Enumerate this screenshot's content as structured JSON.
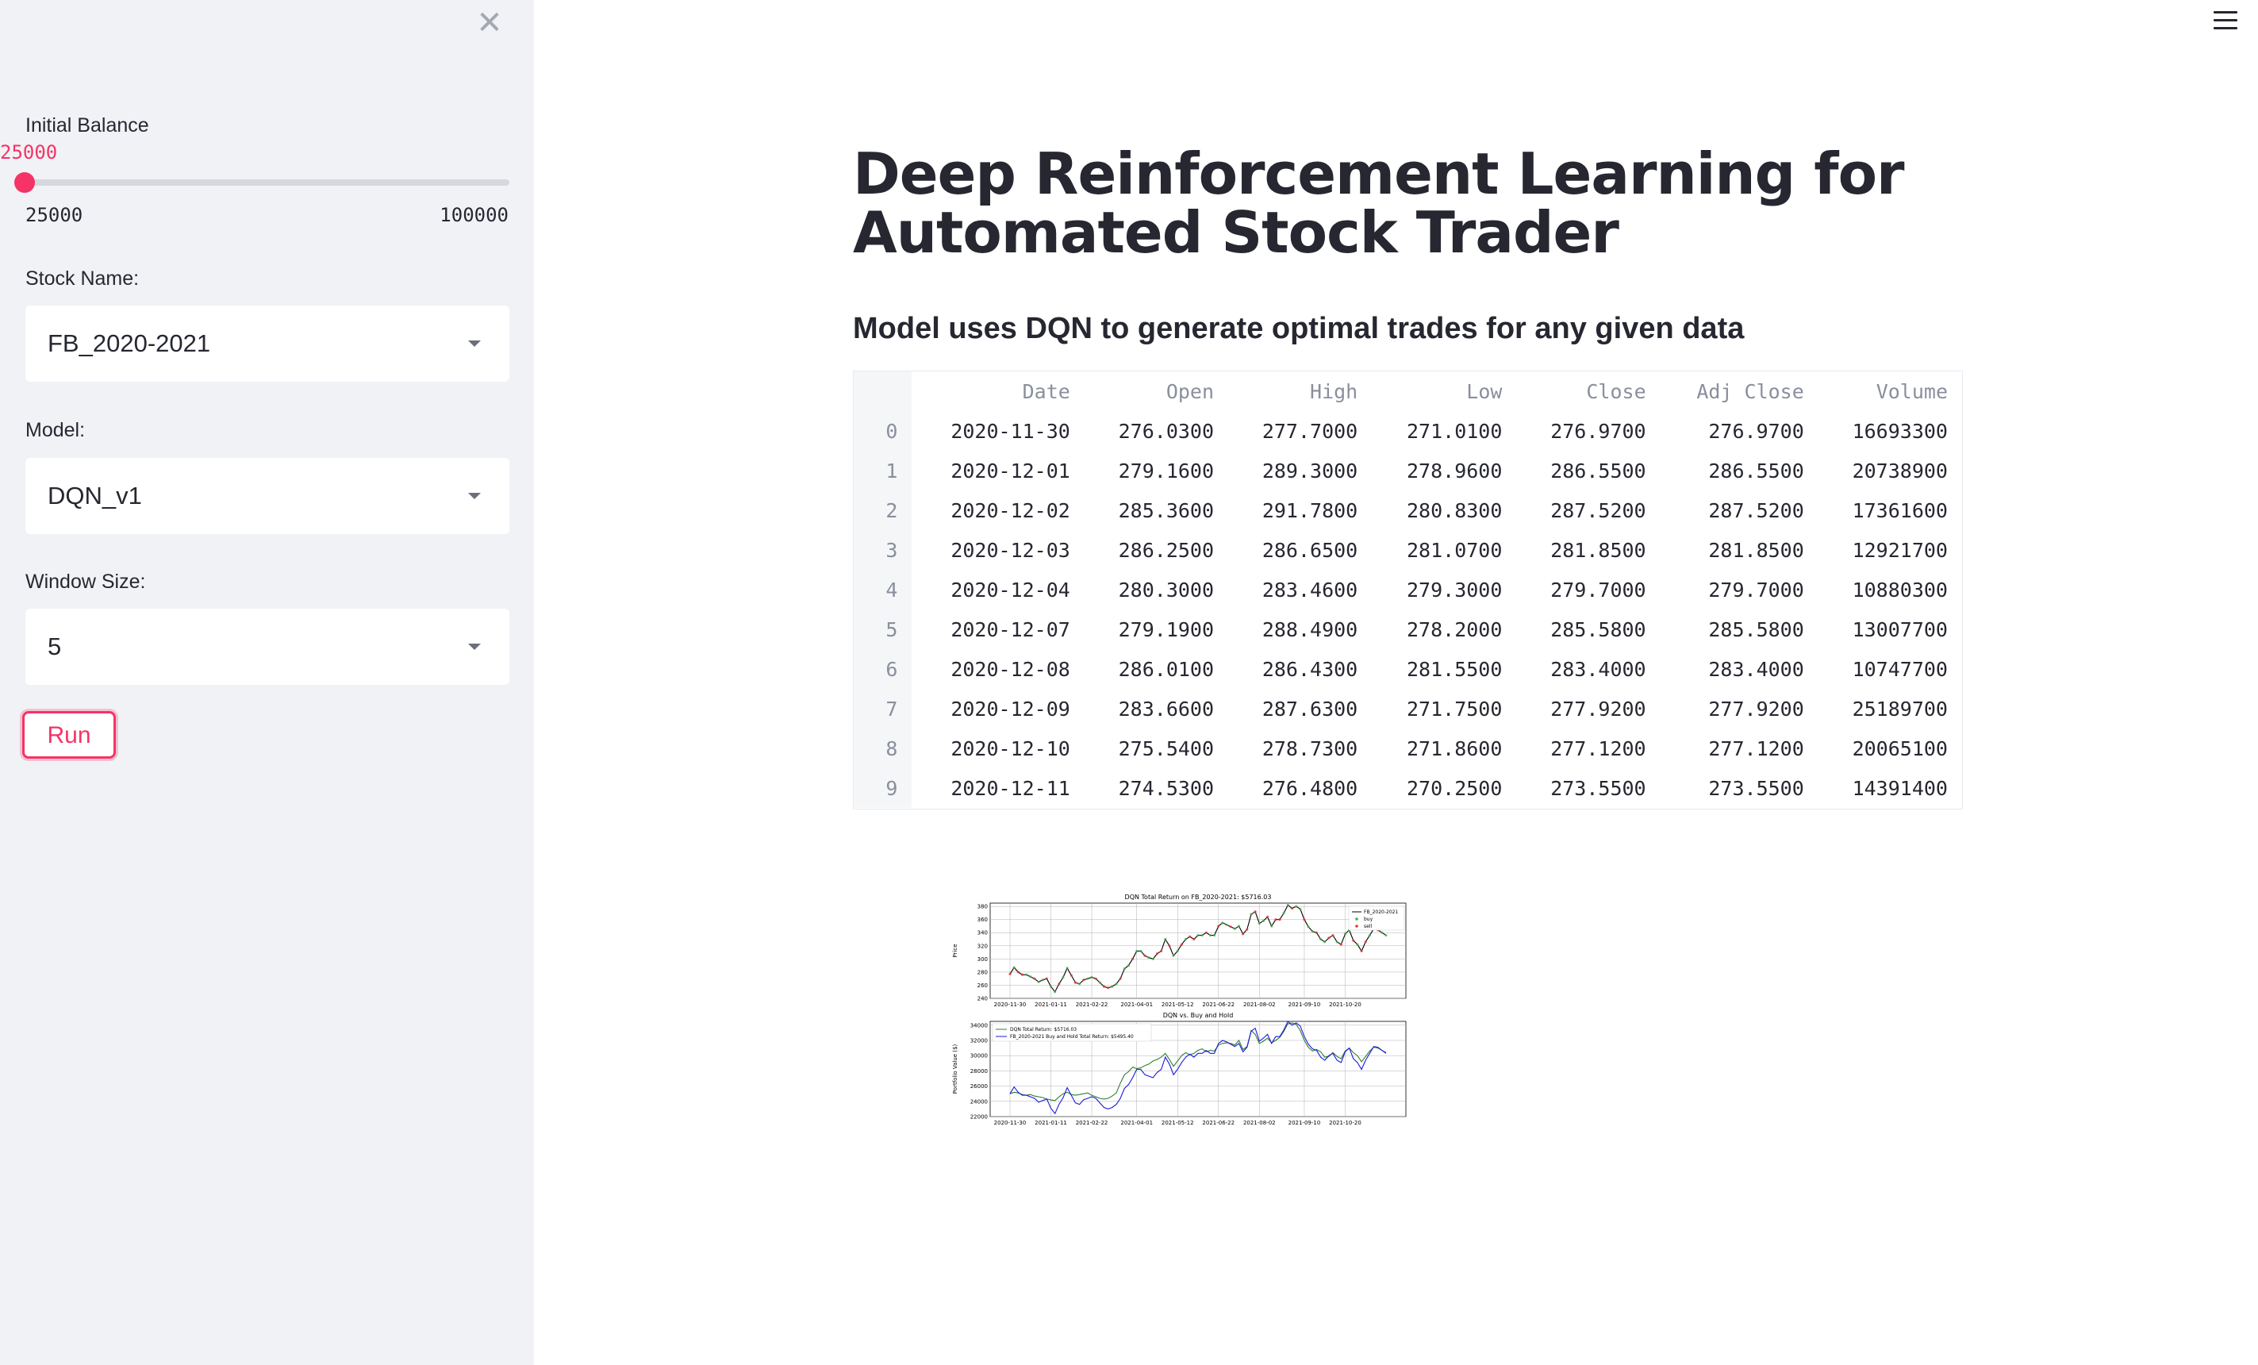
{
  "sidebar": {
    "close_label": "✕",
    "initial_balance": {
      "label": "Initial Balance",
      "value": "25000",
      "min": "25000",
      "max": "100000",
      "fraction": 0.0
    },
    "stock_name": {
      "label": "Stock Name:",
      "value": "FB_2020-2021"
    },
    "model": {
      "label": "Model:",
      "value": "DQN_v1"
    },
    "window_size": {
      "label": "Window Size:",
      "value": "5"
    },
    "run_label": "Run"
  },
  "main": {
    "title_line1": "Deep Reinforcement Learning for",
    "title_line2": "Automated Stock Trader",
    "subtitle": "Model uses DQN to generate optimal trades for any given data",
    "table": {
      "columns": [
        "Date",
        "Open",
        "High",
        "Low",
        "Close",
        "Adj Close",
        "Volume"
      ],
      "rows": [
        [
          "0",
          "2020-11-30",
          "276.0300",
          "277.7000",
          "271.0100",
          "276.9700",
          "276.9700",
          "16693300"
        ],
        [
          "1",
          "2020-12-01",
          "279.1600",
          "289.3000",
          "278.9600",
          "286.5500",
          "286.5500",
          "20738900"
        ],
        [
          "2",
          "2020-12-02",
          "285.3600",
          "291.7800",
          "280.8300",
          "287.5200",
          "287.5200",
          "17361600"
        ],
        [
          "3",
          "2020-12-03",
          "286.2500",
          "286.6500",
          "281.0700",
          "281.8500",
          "281.8500",
          "12921700"
        ],
        [
          "4",
          "2020-12-04",
          "280.3000",
          "283.4600",
          "279.3000",
          "279.7000",
          "279.7000",
          "10880300"
        ],
        [
          "5",
          "2020-12-07",
          "279.1900",
          "288.4900",
          "278.2000",
          "285.5800",
          "285.5800",
          "13007700"
        ],
        [
          "6",
          "2020-12-08",
          "286.0100",
          "286.4300",
          "281.5500",
          "283.4000",
          "283.4000",
          "10747700"
        ],
        [
          "7",
          "2020-12-09",
          "283.6600",
          "287.6300",
          "271.7500",
          "277.9200",
          "277.9200",
          "25189700"
        ],
        [
          "8",
          "2020-12-10",
          "275.5400",
          "278.7300",
          "271.8600",
          "277.1200",
          "277.1200",
          "20065100"
        ],
        [
          "9",
          "2020-12-11",
          "274.5300",
          "276.4800",
          "270.2500",
          "273.5500",
          "273.5500",
          "14391400"
        ]
      ]
    }
  },
  "chart_data": [
    {
      "type": "line",
      "title": "DQN Total Return on FB_2020-2021: $5716.03",
      "xlabel": "",
      "ylabel": "Price",
      "ylim": [
        240,
        385
      ],
      "grid": true,
      "legend_position": "top-right",
      "xtick_labels": [
        "2020-11-30",
        "2021-01-11",
        "2021-02-22",
        "2021-04-01",
        "2021-05-12",
        "2021-06-22",
        "2021-08-02",
        "2021-09-10",
        "2021-10-20"
      ],
      "yticks": [
        240,
        260,
        280,
        300,
        320,
        340,
        360,
        380
      ],
      "series": [
        {
          "name": "FB_2020-2021",
          "color": "#000000",
          "values": [
            277,
            287,
            280,
            276,
            276,
            273,
            270,
            265,
            268,
            270,
            258,
            250,
            262,
            272,
            286,
            275,
            264,
            262,
            268,
            270,
            272,
            270,
            264,
            258,
            256,
            258,
            262,
            270,
            285,
            290,
            300,
            312,
            312,
            305,
            302,
            300,
            308,
            312,
            330,
            320,
            305,
            312,
            322,
            330,
            334,
            330,
            336,
            336,
            340,
            336,
            336,
            350,
            355,
            352,
            349,
            346,
            350,
            338,
            345,
            368,
            372,
            354,
            358,
            364,
            350,
            360,
            360,
            370,
            382,
            377,
            380,
            376,
            360,
            349,
            342,
            340,
            330,
            326,
            332,
            336,
            326,
            322,
            338,
            344,
            328,
            322,
            312,
            326,
            336,
            346,
            344,
            340,
            336
          ]
        },
        {
          "name": "buy",
          "color": "#4caf50",
          "kind": "scatter"
        },
        {
          "name": "sell",
          "color": "#e53935",
          "kind": "scatter"
        }
      ]
    },
    {
      "type": "line",
      "title": "DQN vs. Buy and Hold",
      "xlabel": "",
      "ylabel": "Portfolio Value ($)",
      "ylim": [
        22000,
        34500
      ],
      "grid": true,
      "legend_position": "top-left",
      "xtick_labels": [
        "2020-11-30",
        "2021-01-11",
        "2021-02-22",
        "2021-04-01",
        "2021-05-12",
        "2021-06-22",
        "2021-08-02",
        "2021-09-10",
        "2021-10-20"
      ],
      "yticks": [
        22000,
        24000,
        26000,
        28000,
        30000,
        32000,
        34000
      ],
      "series": [
        {
          "name": "DQN Total Return: $5716.03",
          "color": "#2e7d32",
          "values": [
            25000,
            25200,
            25100,
            24900,
            24800,
            24900,
            24700,
            24600,
            24500,
            24300,
            24200,
            24100,
            24600,
            25000,
            25200,
            24900,
            24800,
            24900,
            25000,
            25100,
            24800,
            24600,
            24400,
            24300,
            24400,
            24700,
            25100,
            26400,
            27500,
            27900,
            28500,
            28300,
            28400,
            28700,
            28900,
            29300,
            29500,
            29800,
            30300,
            29500,
            28600,
            29300,
            30000,
            30400,
            30100,
            30300,
            30700,
            30900,
            30500,
            30700,
            30600,
            31400,
            31600,
            31700,
            31600,
            31400,
            32000,
            30800,
            31200,
            33300,
            32800,
            31600,
            31900,
            32300,
            31700,
            32000,
            32400,
            33200,
            34200,
            34300,
            34100,
            33300,
            32000,
            31100,
            30600,
            30800,
            30500,
            29800,
            29900,
            30400,
            29900,
            29600,
            30600,
            31000,
            30400,
            30000,
            29200,
            29900,
            30600,
            31100,
            31000,
            30700,
            30400
          ]
        },
        {
          "name": "FB_2020-2021 Buy and Hold Total Return: $5495.40",
          "color": "#1a1adb",
          "values": [
            25000,
            25900,
            25200,
            24800,
            24800,
            24600,
            24400,
            23900,
            24100,
            24300,
            23100,
            22400,
            23600,
            24500,
            25800,
            24800,
            23800,
            23600,
            24200,
            24400,
            24600,
            24400,
            23800,
            23200,
            23000,
            23200,
            23600,
            24400,
            25700,
            26200,
            27100,
            28200,
            28200,
            27500,
            27300,
            27100,
            27800,
            28200,
            29800,
            28900,
            27500,
            28200,
            29100,
            29800,
            30200,
            29800,
            30300,
            30300,
            30700,
            30300,
            30300,
            31600,
            32000,
            31800,
            31500,
            31200,
            31600,
            30500,
            31100,
            33200,
            33600,
            31900,
            32300,
            32800,
            31600,
            32500,
            32500,
            33400,
            34500,
            34000,
            34300,
            33900,
            32500,
            31500,
            30900,
            30700,
            29800,
            29400,
            30000,
            30300,
            29400,
            29100,
            30500,
            31000,
            29600,
            29100,
            28200,
            29400,
            30300,
            31200,
            31100,
            30700,
            30300
          ]
        }
      ]
    }
  ]
}
